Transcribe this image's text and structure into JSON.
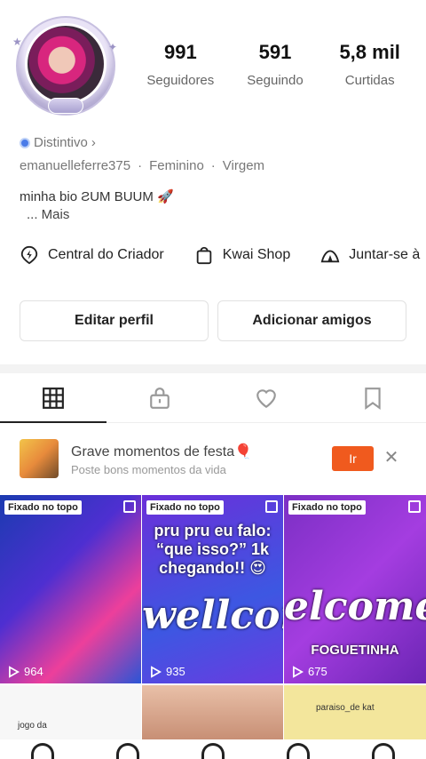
{
  "profile": {
    "stats": [
      {
        "value": "991",
        "label": "Seguidores"
      },
      {
        "value": "591",
        "label": "Seguindo"
      },
      {
        "value": "5,8 mil",
        "label": "Curtidas"
      }
    ],
    "badge_label": "Distintivo",
    "username": "emanuelleferre375",
    "gender": "Feminino",
    "sign": "Virgem",
    "bio": "minha bio ƧUM BUUM 🚀",
    "more_label": "... Mais"
  },
  "tools": [
    {
      "label": "Central do Criador",
      "icon": "lightning-pin-icon"
    },
    {
      "label": "Kwai Shop",
      "icon": "shopping-bag-icon"
    },
    {
      "label": "Juntar-se à",
      "icon": "tent-icon"
    }
  ],
  "buttons": {
    "edit": "Editar perfil",
    "add_friends": "Adicionar amigos"
  },
  "tabs": [
    {
      "icon": "grid-icon",
      "active": true
    },
    {
      "icon": "lock-icon",
      "active": false
    },
    {
      "icon": "heart-icon",
      "active": false
    },
    {
      "icon": "bookmark-icon",
      "active": false
    }
  ],
  "promo": {
    "title": "Grave momentos de festa🎈",
    "subtitle": "Poste bons momentos da vida",
    "go_label": "Ir",
    "close_icon": "close-icon"
  },
  "videos": [
    {
      "pinned": "Fixado no topo",
      "plays": "964",
      "caption": ""
    },
    {
      "pinned": "Fixado no topo",
      "plays": "935",
      "caption": "pru pru eu falo: “que isso?” 1k chegando!! 😍",
      "overlay": "wellcome"
    },
    {
      "pinned": "Fixado no topo",
      "plays": "675",
      "caption": "",
      "overlay": "elcome",
      "overlay2": "FOGUETINHA"
    },
    {
      "caption": "jogo da"
    },
    {
      "caption": ""
    },
    {
      "caption": "paraiso_de kat"
    }
  ],
  "colors": {
    "accent": "#f05a1e",
    "badge": "#4a7be8"
  }
}
